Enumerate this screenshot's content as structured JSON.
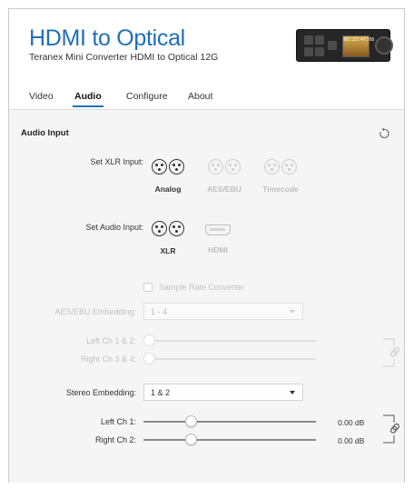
{
  "header": {
    "title": "HDMI to Optical",
    "subtitle": "Teranex Mini Converter HDMI to Optical 12G",
    "device_screen_text": "01:23:47:08"
  },
  "tabs": [
    {
      "label": "Video",
      "active": false
    },
    {
      "label": "Audio",
      "active": true
    },
    {
      "label": "Configure",
      "active": false
    },
    {
      "label": "About",
      "active": false
    }
  ],
  "audio_input": {
    "section_title": "Audio Input",
    "xlr_input": {
      "label": "Set XLR Input:",
      "options": [
        {
          "label": "Analog",
          "selected": true,
          "enabled": true
        },
        {
          "label": "AES/EBU",
          "selected": false,
          "enabled": false
        },
        {
          "label": "Timecode",
          "selected": false,
          "enabled": false
        }
      ]
    },
    "audio_input": {
      "label": "Set Audio Input:",
      "options": [
        {
          "label": "XLR",
          "selected": true,
          "enabled": true,
          "icon": "xlr-icon"
        },
        {
          "label": "HDMI",
          "selected": false,
          "enabled": false,
          "icon": "hdmi-icon"
        }
      ]
    },
    "sample_rate_converter": {
      "label": "Sample Rate Converter",
      "checked": false,
      "enabled": false
    },
    "aes_embedding": {
      "label": "AES/EBU Embedding:",
      "value": "1 - 4",
      "enabled": false
    },
    "aes_sliders": [
      {
        "label": "Left Ch 1 & 2:",
        "level": 0.0,
        "enabled": false
      },
      {
        "label": "Right Ch 3 & 4:",
        "level": 0.0,
        "enabled": false
      }
    ],
    "stereo_embedding": {
      "label": "Stereo Embedding:",
      "value": "1 & 2",
      "enabled": true
    },
    "stereo_sliders": [
      {
        "label": "Left Ch 1:",
        "value": "0.00 dB",
        "level": 0.27,
        "enabled": true
      },
      {
        "label": "Right Ch 2:",
        "value": "0.00 dB",
        "level": 0.27,
        "enabled": true
      }
    ]
  },
  "colors": {
    "accent": "#1f6fb8",
    "panel_bg": "#f5f5f5",
    "disabled_text": "#c0c0c0"
  }
}
